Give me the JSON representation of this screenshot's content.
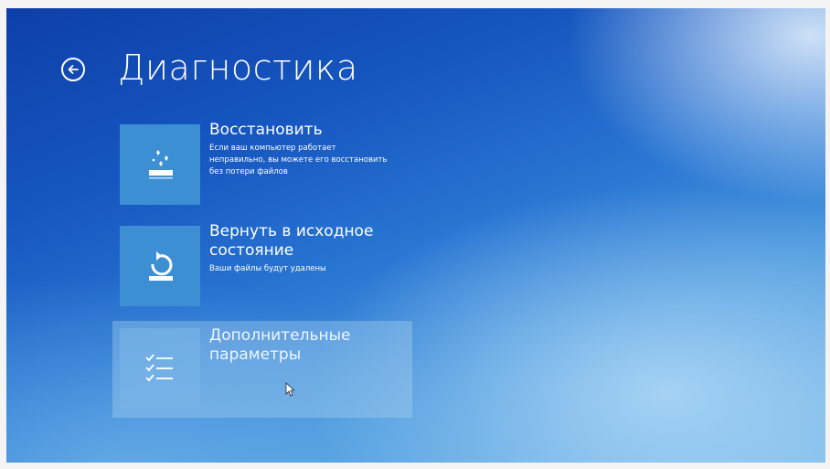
{
  "header": {
    "title": "Диагностика",
    "back_icon": "back-arrow-circle-icon"
  },
  "options": [
    {
      "title": "Восстановить",
      "description": "Если ваш компьютер работает неправильно, вы можете его восстановить без потери файлов",
      "icon": "refresh-sparkle-icon"
    },
    {
      "title": "Вернуть в исходное состояние",
      "description": "Ваши файлы будут удалены",
      "icon": "reset-circular-arrow-icon"
    },
    {
      "title": "Дополнительные параметры",
      "description": "",
      "icon": "checklist-icon",
      "selected": true
    }
  ],
  "colors": {
    "background_top": "#0e3fa8",
    "background_bottom": "#74b6e8",
    "tile_icon": "#3d8fd3",
    "text": "#ffffff"
  }
}
